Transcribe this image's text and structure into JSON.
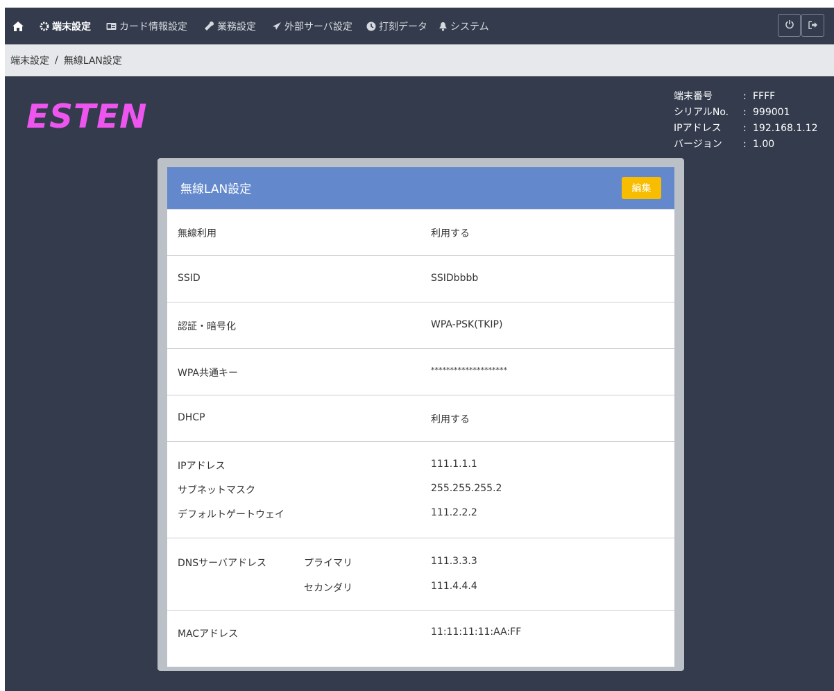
{
  "nav": {
    "home_icon": "home-icon",
    "items": [
      {
        "icon": "gear-icon",
        "label": "端末設定",
        "active": true
      },
      {
        "icon": "card-icon",
        "label": "カード情報設定"
      },
      {
        "icon": "wrench-icon",
        "label": "業務設定"
      },
      {
        "icon": "send-icon",
        "label": "外部サーバ設定"
      },
      {
        "icon": "clock-icon",
        "label": "打刻データ"
      },
      {
        "icon": "bell-icon",
        "label": "システム"
      }
    ],
    "right_buttons": [
      "power-icon",
      "logout-icon"
    ]
  },
  "breadcrumb": {
    "parent": "端末設定",
    "separator": "/",
    "current": "無線LAN設定"
  },
  "logo": {
    "text": "ESTEN"
  },
  "device": {
    "items": [
      {
        "key": "端末番号",
        "colon": ":",
        "value": "FFFF"
      },
      {
        "key": "シリアルNo.",
        "colon": ":",
        "value": "999001"
      },
      {
        "key": "IPアドレス",
        "colon": ":",
        "value": "192.168.1.12"
      },
      {
        "key": "バージョン",
        "colon": ":",
        "value": "1.00"
      }
    ]
  },
  "panel": {
    "title": "無線LAN設定",
    "edit_label": "編集",
    "wireless": {
      "label": "無線利用",
      "value": "利用する"
    },
    "ssid": {
      "label": "SSID",
      "value": "SSIDbbbb"
    },
    "auth": {
      "label": "認証・暗号化",
      "value": "WPA-PSK(TKIP)"
    },
    "wpa_key": {
      "label": "WPA共通キー",
      "value": "********************"
    },
    "dhcp": {
      "label": "DHCP",
      "value": "利用する"
    },
    "ip": {
      "label": "IPアドレス",
      "value": "111.1.1.1"
    },
    "subnet": {
      "label": "サブネットマスク",
      "value": "255.255.255.2"
    },
    "gateway": {
      "label": "デフォルトゲートウェイ",
      "value": "111.2.2.2"
    },
    "dns": {
      "label": "DNSサーバアドレス",
      "primary_label": "プライマリ",
      "primary_value": "111.3.3.3",
      "secondary_label": "セカンダリ",
      "secondary_value": "111.4.4.4"
    },
    "mac": {
      "label": "MACアドレス",
      "value": "11:11:11:11:AA:FF"
    }
  },
  "colors": {
    "navbar": "#333b4c",
    "breadcrumb": "#e6e8ec",
    "panel_header": "#6389cc",
    "edit_button": "#f8bd00",
    "logo": "#ee55ee"
  }
}
